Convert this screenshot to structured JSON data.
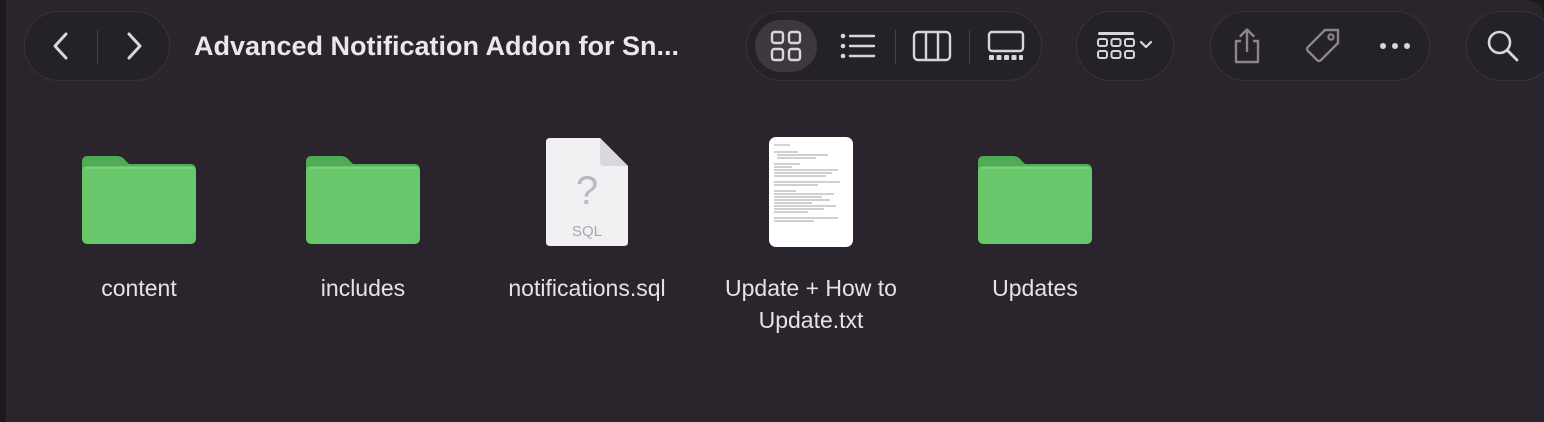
{
  "window": {
    "title": "Advanced Notification Addon for Sn..."
  },
  "toolbar": {
    "back_icon": "chevron-left-icon",
    "forward_icon": "chevron-right-icon",
    "views": [
      {
        "name": "icon-view",
        "icon": "grid-icon",
        "selected": true
      },
      {
        "name": "list-view",
        "icon": "list-icon",
        "selected": false
      },
      {
        "name": "column-view",
        "icon": "columns-icon",
        "selected": false
      },
      {
        "name": "gallery-view",
        "icon": "gallery-icon",
        "selected": false
      }
    ],
    "group_icon": "group-grid-icon",
    "share_icon": "share-icon",
    "tag_icon": "tag-icon",
    "more_icon": "ellipsis-icon",
    "search_icon": "search-icon"
  },
  "files": [
    {
      "name": "content",
      "kind": "folder"
    },
    {
      "name": "includes",
      "kind": "folder"
    },
    {
      "name": "notifications.sql",
      "kind": "sql",
      "badge": "SQL",
      "glyph": "?"
    },
    {
      "name": "Update + How to Update.txt",
      "kind": "text"
    },
    {
      "name": "Updates",
      "kind": "folder"
    }
  ],
  "colors": {
    "background": "#2a252c",
    "folder_front": "#67c76a",
    "folder_back": "#4fab55",
    "text": "#e6e3e8"
  }
}
